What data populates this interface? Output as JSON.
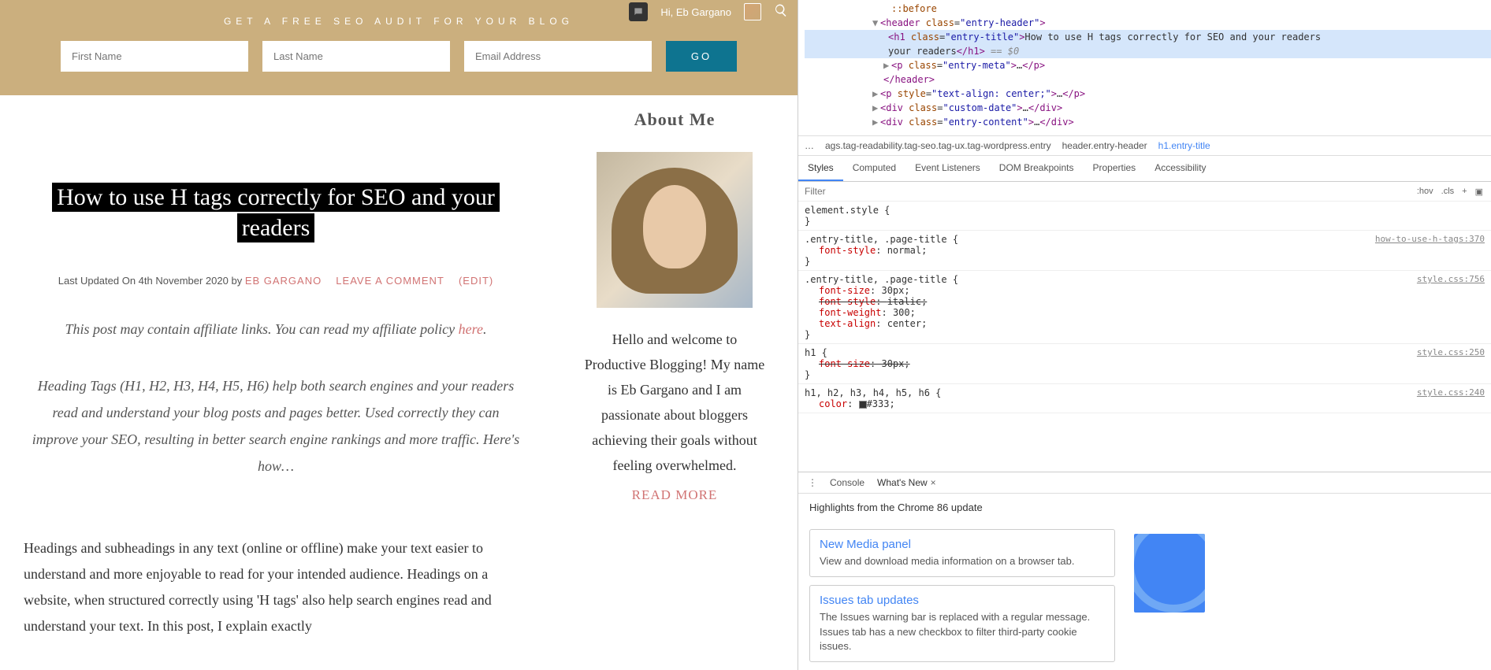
{
  "topbar": {
    "greeting": "Hi, Eb Gargano"
  },
  "optin": {
    "title": "GET A FREE SEO AUDIT FOR YOUR BLOG",
    "first_name_ph": "First Name",
    "last_name_ph": "Last Name",
    "email_ph": "Email Address",
    "button": "GO"
  },
  "article": {
    "title": "How to use H tags correctly for SEO and your readers",
    "meta_prefix": "Last Updated On 4th November 2020 by ",
    "author": "EB GARGANO",
    "leave_comment": "LEAVE A COMMENT",
    "edit": "(EDIT)",
    "affiliate_pre": "This post may contain affiliate links. You can read my affiliate policy ",
    "affiliate_link": "here",
    "affiliate_post": ".",
    "lede": "Heading Tags (H1, H2, H3, H4, H5, H6) help both search engines and your readers read and understand your blog posts and pages better. Used correctly they can improve your SEO, resulting in better search engine rankings and more traffic. Here's how…",
    "body": "Headings and subheadings in any text (online or offline) make your text easier to understand and more enjoyable to read for your intended audience. Headings on a website, when structured correctly using 'H tags' also help search engines read and understand your text. In this post, I explain exactly"
  },
  "sidebar": {
    "about_title": "About Me",
    "about_text": "Hello and welcome to Productive Blogging! My name is Eb Gargano and I am passionate about bloggers achieving their goals without feeling overwhelmed.",
    "read_more": "READ MORE"
  },
  "devtools": {
    "dom": {
      "before": "::before",
      "header_open": "<header class=\"entry-header\">",
      "h1_open": "<h1 class=\"entry-title\">",
      "h1_text": "How to use H tags correctly for SEO and your readers",
      "h1_close": "</h1>",
      "eq0": " == $0",
      "p_meta": "<p class=\"entry-meta\">…</p>",
      "header_close": "</header>",
      "p_center": "<p style=\"text-align: center;\">…</p>",
      "div_date": "<div class=\"custom-date\">…</div>",
      "div_content": "<div class=\"entry-content\">…</div>"
    },
    "crumbs": {
      "c1": "…",
      "c2": "ags.tag-readability.tag-seo.tag-ux.tag-wordpress.entry",
      "c3": "header.entry-header",
      "c4": "h1.entry-title"
    },
    "tabs": {
      "styles": "Styles",
      "computed": "Computed",
      "listeners": "Event Listeners",
      "dom": "DOM Breakpoints",
      "props": "Properties",
      "a11y": "Accessibility"
    },
    "filter_ph": "Filter",
    "hov": ":hov",
    "cls": ".cls",
    "rules": {
      "element_style": "element.style {",
      "r1_sel": ".entry-title, .page-title {",
      "r1_src": "how-to-use-h-tags:370",
      "r1_p1": "font-style: normal;",
      "r2_sel": ".entry-title, .page-title {",
      "r2_src": "style.css:756",
      "r2_p1": "font-size: 30px;",
      "r2_p2": "font-style: italic;",
      "r2_p3": "font-weight: 300;",
      "r2_p4": "text-align: center;",
      "r3_sel": "h1 {",
      "r3_src": "style.css:250",
      "r3_p1": "font-size: 30px;",
      "r4_sel": "h1, h2, h3, h4, h5, h6 {",
      "r4_src": "style.css:240",
      "r4_p1": "color: ",
      "r4_cv": "#333;",
      "close": "}"
    },
    "drawer": {
      "console": "Console",
      "whatsnew": "What's New",
      "highlights": "Highlights from the Chrome 86 update",
      "c1_title": "New Media panel",
      "c1_text": "View and download media information on a browser tab.",
      "c2_title": "Issues tab updates",
      "c2_text": "The Issues warning bar is replaced with a regular message. Issues tab has a new checkbox to filter third-party cookie issues."
    }
  }
}
